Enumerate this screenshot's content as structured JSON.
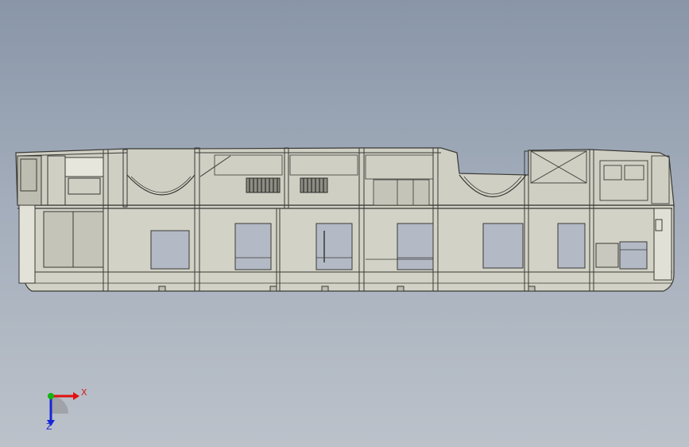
{
  "viewport": {
    "name": "cad-graphics-area"
  },
  "triad": {
    "x_label": "X",
    "z_label": "Z",
    "x_color": "#e01010",
    "y_color": "#12b312",
    "z_color": "#1626d8"
  },
  "colors": {
    "body_fill": "#d4d4c8",
    "line": "#3a3a36",
    "window": "#b6bcc6"
  }
}
